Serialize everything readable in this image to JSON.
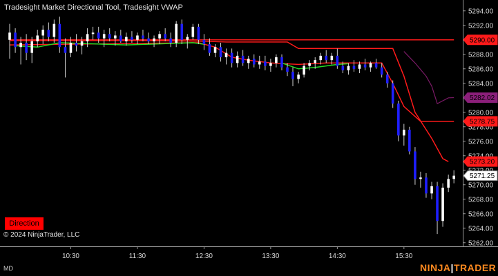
{
  "title": "Tradesight Market Directional Tool, Tradesight VWAP",
  "copyright": "© 2024 NinjaTrader, LLC",
  "direction_label": "Direction",
  "mode_label": "MD",
  "brand": {
    "part1": "NINJA",
    "sep": "|",
    "part2": "TRADER"
  },
  "colors": {
    "background": "#000000",
    "up_candle": "#ffffff",
    "down_candle": "#1f1fff",
    "wick": "#cfcfcf",
    "red_line": "#ff1a1a",
    "green_line": "#22dd22",
    "purple_line": "#7a1a66",
    "label_text": "#000000",
    "axis_text": "#d8d8d8",
    "grid": "#1c1c1c"
  },
  "chart_data": {
    "type": "candlestick",
    "title": "Tradesight Market Directional Tool, Tradesight VWAP",
    "ylim": [
      5261.5,
      5295.5
    ],
    "y_ticks": [
      5262.0,
      5264.0,
      5266.0,
      5268.0,
      5270.0,
      5272.0,
      5274.0,
      5276.0,
      5278.0,
      5280.0,
      5282.0,
      5284.0,
      5286.0,
      5288.0,
      5290.0,
      5292.0,
      5294.0
    ],
    "y_tick_labels": [
      "5262.00",
      "5264.00",
      "5266.00",
      "5268.00",
      "5270.00",
      "5272.00",
      "5274.00",
      "5276.00",
      "5278.00",
      "5280.00",
      "5282.00",
      "5284.00",
      "5286.00",
      "5288.00",
      "5290.00",
      "5292.00",
      "5294.00"
    ],
    "x_ticks": [
      10.5,
      11.5,
      12.5,
      13.5,
      14.5,
      15.5
    ],
    "x_tick_labels": [
      "10:30",
      "11:30",
      "12:30",
      "13:30",
      "14:30",
      "15:30"
    ],
    "xlim": [
      9.583,
      16.3
    ],
    "price_labels": [
      {
        "value": 5290.0,
        "text": "5290.00",
        "color": "#ff1a1a"
      },
      {
        "value": 5282.02,
        "text": "5282.02",
        "color": "#8b1f7a"
      },
      {
        "value": 5278.75,
        "text": "5278.75",
        "color": "#ff1a1a"
      },
      {
        "value": 5273.2,
        "text": "5273.20",
        "color": "#ff1a1a"
      },
      {
        "value": 5271.25,
        "text": "5271.25",
        "color": "#ffffff"
      }
    ],
    "candles": [
      {
        "t": 9.583,
        "o": 5290.0,
        "h": 5292.2,
        "l": 5287.4,
        "c": 5291.0
      },
      {
        "t": 9.667,
        "o": 5291.0,
        "h": 5291.6,
        "l": 5288.2,
        "c": 5289.0
      },
      {
        "t": 9.75,
        "o": 5289.0,
        "h": 5290.4,
        "l": 5286.6,
        "c": 5289.6
      },
      {
        "t": 9.833,
        "o": 5289.6,
        "h": 5290.8,
        "l": 5287.2,
        "c": 5288.2
      },
      {
        "t": 9.917,
        "o": 5288.2,
        "h": 5290.4,
        "l": 5286.8,
        "c": 5289.8
      },
      {
        "t": 10.0,
        "o": 5289.8,
        "h": 5291.4,
        "l": 5289.0,
        "c": 5290.6
      },
      {
        "t": 10.083,
        "o": 5290.6,
        "h": 5292.0,
        "l": 5289.4,
        "c": 5291.4
      },
      {
        "t": 10.167,
        "o": 5291.4,
        "h": 5292.4,
        "l": 5289.8,
        "c": 5290.4
      },
      {
        "t": 10.25,
        "o": 5290.4,
        "h": 5292.8,
        "l": 5289.6,
        "c": 5292.2
      },
      {
        "t": 10.333,
        "o": 5292.2,
        "h": 5293.2,
        "l": 5288.2,
        "c": 5289.0
      },
      {
        "t": 10.417,
        "o": 5289.0,
        "h": 5290.2,
        "l": 5284.8,
        "c": 5288.2
      },
      {
        "t": 10.5,
        "o": 5288.2,
        "h": 5290.4,
        "l": 5287.6,
        "c": 5289.6
      },
      {
        "t": 10.583,
        "o": 5289.6,
        "h": 5290.8,
        "l": 5288.4,
        "c": 5289.2
      },
      {
        "t": 10.667,
        "o": 5289.2,
        "h": 5290.4,
        "l": 5288.0,
        "c": 5289.8
      },
      {
        "t": 10.75,
        "o": 5289.8,
        "h": 5291.6,
        "l": 5289.0,
        "c": 5290.8
      },
      {
        "t": 10.833,
        "o": 5290.8,
        "h": 5291.8,
        "l": 5290.0,
        "c": 5291.0
      },
      {
        "t": 10.917,
        "o": 5291.0,
        "h": 5291.8,
        "l": 5289.6,
        "c": 5290.2
      },
      {
        "t": 11.0,
        "o": 5290.2,
        "h": 5291.4,
        "l": 5289.0,
        "c": 5290.8
      },
      {
        "t": 11.083,
        "o": 5290.8,
        "h": 5291.6,
        "l": 5289.8,
        "c": 5290.2
      },
      {
        "t": 11.167,
        "o": 5290.2,
        "h": 5291.2,
        "l": 5289.2,
        "c": 5290.6
      },
      {
        "t": 11.25,
        "o": 5290.6,
        "h": 5291.4,
        "l": 5289.6,
        "c": 5289.8
      },
      {
        "t": 11.333,
        "o": 5289.8,
        "h": 5291.0,
        "l": 5289.2,
        "c": 5290.4
      },
      {
        "t": 11.417,
        "o": 5290.4,
        "h": 5291.2,
        "l": 5289.6,
        "c": 5290.0
      },
      {
        "t": 11.5,
        "o": 5290.0,
        "h": 5291.0,
        "l": 5289.4,
        "c": 5290.6
      },
      {
        "t": 11.583,
        "o": 5290.6,
        "h": 5291.4,
        "l": 5289.8,
        "c": 5290.2
      },
      {
        "t": 11.667,
        "o": 5290.2,
        "h": 5291.0,
        "l": 5289.4,
        "c": 5289.8
      },
      {
        "t": 11.75,
        "o": 5289.8,
        "h": 5290.6,
        "l": 5289.0,
        "c": 5290.2
      },
      {
        "t": 11.833,
        "o": 5290.2,
        "h": 5291.2,
        "l": 5289.4,
        "c": 5290.8
      },
      {
        "t": 11.917,
        "o": 5290.8,
        "h": 5291.6,
        "l": 5289.8,
        "c": 5290.2
      },
      {
        "t": 12.0,
        "o": 5290.2,
        "h": 5291.0,
        "l": 5289.0,
        "c": 5289.6
      },
      {
        "t": 12.083,
        "o": 5289.6,
        "h": 5292.6,
        "l": 5289.0,
        "c": 5292.2
      },
      {
        "t": 12.167,
        "o": 5292.2,
        "h": 5292.8,
        "l": 5289.4,
        "c": 5290.0
      },
      {
        "t": 12.25,
        "o": 5290.0,
        "h": 5290.8,
        "l": 5288.8,
        "c": 5290.4
      },
      {
        "t": 12.333,
        "o": 5290.4,
        "h": 5292.2,
        "l": 5290.0,
        "c": 5291.8
      },
      {
        "t": 12.417,
        "o": 5291.8,
        "h": 5292.2,
        "l": 5289.4,
        "c": 5290.0
      },
      {
        "t": 12.5,
        "o": 5290.0,
        "h": 5290.8,
        "l": 5288.6,
        "c": 5289.4
      },
      {
        "t": 12.583,
        "o": 5289.4,
        "h": 5290.2,
        "l": 5287.8,
        "c": 5288.2
      },
      {
        "t": 12.667,
        "o": 5288.2,
        "h": 5289.4,
        "l": 5287.6,
        "c": 5289.0
      },
      {
        "t": 12.75,
        "o": 5289.0,
        "h": 5289.6,
        "l": 5287.0,
        "c": 5287.6
      },
      {
        "t": 12.833,
        "o": 5287.6,
        "h": 5288.8,
        "l": 5286.6,
        "c": 5288.2
      },
      {
        "t": 12.917,
        "o": 5288.2,
        "h": 5288.8,
        "l": 5286.2,
        "c": 5286.8
      },
      {
        "t": 13.0,
        "o": 5286.8,
        "h": 5288.4,
        "l": 5286.2,
        "c": 5287.8
      },
      {
        "t": 13.083,
        "o": 5287.8,
        "h": 5288.6,
        "l": 5286.4,
        "c": 5286.8
      },
      {
        "t": 13.167,
        "o": 5286.8,
        "h": 5287.8,
        "l": 5286.0,
        "c": 5287.4
      },
      {
        "t": 13.25,
        "o": 5287.4,
        "h": 5288.0,
        "l": 5286.2,
        "c": 5286.6
      },
      {
        "t": 13.333,
        "o": 5286.6,
        "h": 5287.8,
        "l": 5286.0,
        "c": 5287.0
      },
      {
        "t": 13.417,
        "o": 5287.0,
        "h": 5287.8,
        "l": 5285.8,
        "c": 5286.4
      },
      {
        "t": 13.5,
        "o": 5286.4,
        "h": 5287.4,
        "l": 5285.6,
        "c": 5286.8
      },
      {
        "t": 13.583,
        "o": 5286.8,
        "h": 5288.0,
        "l": 5286.2,
        "c": 5287.6
      },
      {
        "t": 13.667,
        "o": 5287.6,
        "h": 5288.0,
        "l": 5285.8,
        "c": 5286.2
      },
      {
        "t": 13.75,
        "o": 5286.2,
        "h": 5286.8,
        "l": 5285.0,
        "c": 5285.6
      },
      {
        "t": 13.833,
        "o": 5285.6,
        "h": 5286.2,
        "l": 5283.6,
        "c": 5284.6
      },
      {
        "t": 13.917,
        "o": 5284.6,
        "h": 5285.6,
        "l": 5284.0,
        "c": 5285.2
      },
      {
        "t": 14.0,
        "o": 5285.2,
        "h": 5286.8,
        "l": 5284.8,
        "c": 5286.4
      },
      {
        "t": 14.083,
        "o": 5286.4,
        "h": 5287.2,
        "l": 5285.8,
        "c": 5286.8
      },
      {
        "t": 14.167,
        "o": 5286.8,
        "h": 5287.6,
        "l": 5286.0,
        "c": 5287.2
      },
      {
        "t": 14.25,
        "o": 5287.2,
        "h": 5288.2,
        "l": 5286.6,
        "c": 5287.8
      },
      {
        "t": 14.333,
        "o": 5287.8,
        "h": 5288.6,
        "l": 5286.8,
        "c": 5287.2
      },
      {
        "t": 14.417,
        "o": 5287.2,
        "h": 5288.2,
        "l": 5286.6,
        "c": 5287.8
      },
      {
        "t": 14.5,
        "o": 5287.8,
        "h": 5288.8,
        "l": 5286.0,
        "c": 5286.4
      },
      {
        "t": 14.583,
        "o": 5286.4,
        "h": 5287.0,
        "l": 5285.4,
        "c": 5285.8
      },
      {
        "t": 14.667,
        "o": 5285.8,
        "h": 5286.8,
        "l": 5285.2,
        "c": 5286.4
      },
      {
        "t": 14.75,
        "o": 5286.4,
        "h": 5287.2,
        "l": 5285.6,
        "c": 5286.0
      },
      {
        "t": 14.833,
        "o": 5286.0,
        "h": 5287.0,
        "l": 5285.4,
        "c": 5286.6
      },
      {
        "t": 14.917,
        "o": 5286.6,
        "h": 5287.4,
        "l": 5285.8,
        "c": 5286.2
      },
      {
        "t": 15.0,
        "o": 5286.2,
        "h": 5287.0,
        "l": 5285.6,
        "c": 5286.8
      },
      {
        "t": 15.083,
        "o": 5286.8,
        "h": 5287.4,
        "l": 5286.0,
        "c": 5286.2
      },
      {
        "t": 15.167,
        "o": 5286.2,
        "h": 5286.8,
        "l": 5284.8,
        "c": 5285.2
      },
      {
        "t": 15.25,
        "o": 5285.2,
        "h": 5285.6,
        "l": 5283.4,
        "c": 5284.0
      },
      {
        "t": 15.333,
        "o": 5284.0,
        "h": 5284.4,
        "l": 5280.6,
        "c": 5281.2
      },
      {
        "t": 15.417,
        "o": 5281.2,
        "h": 5281.6,
        "l": 5276.0,
        "c": 5276.8
      },
      {
        "t": 15.5,
        "o": 5276.8,
        "h": 5278.4,
        "l": 5275.4,
        "c": 5277.6
      },
      {
        "t": 15.583,
        "o": 5277.6,
        "h": 5278.0,
        "l": 5274.2,
        "c": 5274.6
      },
      {
        "t": 15.667,
        "o": 5274.6,
        "h": 5275.2,
        "l": 5270.0,
        "c": 5270.8
      },
      {
        "t": 15.75,
        "o": 5270.8,
        "h": 5271.8,
        "l": 5269.6,
        "c": 5271.0
      },
      {
        "t": 15.833,
        "o": 5271.0,
        "h": 5271.6,
        "l": 5268.2,
        "c": 5268.8
      },
      {
        "t": 15.917,
        "o": 5268.8,
        "h": 5270.4,
        "l": 5268.0,
        "c": 5269.8
      },
      {
        "t": 16.0,
        "o": 5269.8,
        "h": 5270.4,
        "l": 5263.2,
        "c": 5265.0
      },
      {
        "t": 16.083,
        "o": 5265.0,
        "h": 5270.2,
        "l": 5264.2,
        "c": 5269.6
      },
      {
        "t": 16.167,
        "o": 5269.6,
        "h": 5271.4,
        "l": 5269.0,
        "c": 5270.8
      },
      {
        "t": 16.25,
        "o": 5270.8,
        "h": 5272.0,
        "l": 5270.2,
        "c": 5271.25
      }
    ],
    "lines": [
      {
        "color": "#ff1a1a",
        "width": 1.5,
        "points": [
          [
            9.583,
            5289.9
          ],
          [
            10.417,
            5289.9
          ],
          [
            11.5,
            5289.9
          ],
          [
            12.5,
            5289.8
          ],
          [
            12.833,
            5289.7
          ],
          [
            13.75,
            5289.7
          ],
          [
            13.917,
            5288.8
          ],
          [
            15.333,
            5288.8
          ],
          [
            15.5,
            5285.0
          ],
          [
            15.667,
            5280.0
          ],
          [
            15.917,
            5276.4
          ],
          [
            16.083,
            5273.6
          ],
          [
            16.167,
            5273.2
          ]
        ]
      },
      {
        "color": "#ff1a1a",
        "width": 1.5,
        "points": [
          [
            9.583,
            5290.0
          ],
          [
            16.25,
            5290.0
          ]
        ]
      },
      {
        "color": "#ff1a1a",
        "width": 1.5,
        "points": [
          [
            9.583,
            5289.3
          ],
          [
            12.417,
            5289.6
          ],
          [
            12.667,
            5289.0
          ],
          [
            12.917,
            5287.6
          ],
          [
            13.167,
            5287.2
          ],
          [
            13.5,
            5286.8
          ],
          [
            13.917,
            5286.6
          ],
          [
            14.333,
            5286.8
          ],
          [
            15.167,
            5286.8
          ],
          [
            15.333,
            5284.0
          ],
          [
            15.5,
            5280.8
          ],
          [
            15.75,
            5278.75
          ],
          [
            16.25,
            5278.75
          ]
        ]
      },
      {
        "color": "#22dd22",
        "width": 1.5,
        "points": [
          [
            9.667,
            5289.2
          ],
          [
            10.0,
            5289.0
          ],
          [
            10.333,
            5289.6
          ],
          [
            10.667,
            5289.5
          ],
          [
            11.0,
            5289.4
          ],
          [
            11.333,
            5289.3
          ],
          [
            11.667,
            5289.4
          ],
          [
            12.0,
            5289.5
          ],
          [
            12.333,
            5289.6
          ],
          [
            12.5,
            5289.4
          ]
        ]
      },
      {
        "color": "#22dd22",
        "width": 1.5,
        "points": [
          [
            13.667,
            5286.8
          ],
          [
            13.917,
            5286.0
          ],
          [
            14.167,
            5286.2
          ],
          [
            14.5,
            5286.6
          ],
          [
            14.667,
            5286.7
          ]
        ]
      },
      {
        "color": "#7a1a66",
        "width": 1.2,
        "points": [
          [
            15.5,
            5288.4
          ],
          [
            15.667,
            5286.8
          ],
          [
            15.833,
            5285.0
          ],
          [
            15.917,
            5283.6
          ],
          [
            16.0,
            5281.2
          ],
          [
            16.167,
            5282.0
          ],
          [
            16.25,
            5282.02
          ]
        ]
      }
    ]
  }
}
